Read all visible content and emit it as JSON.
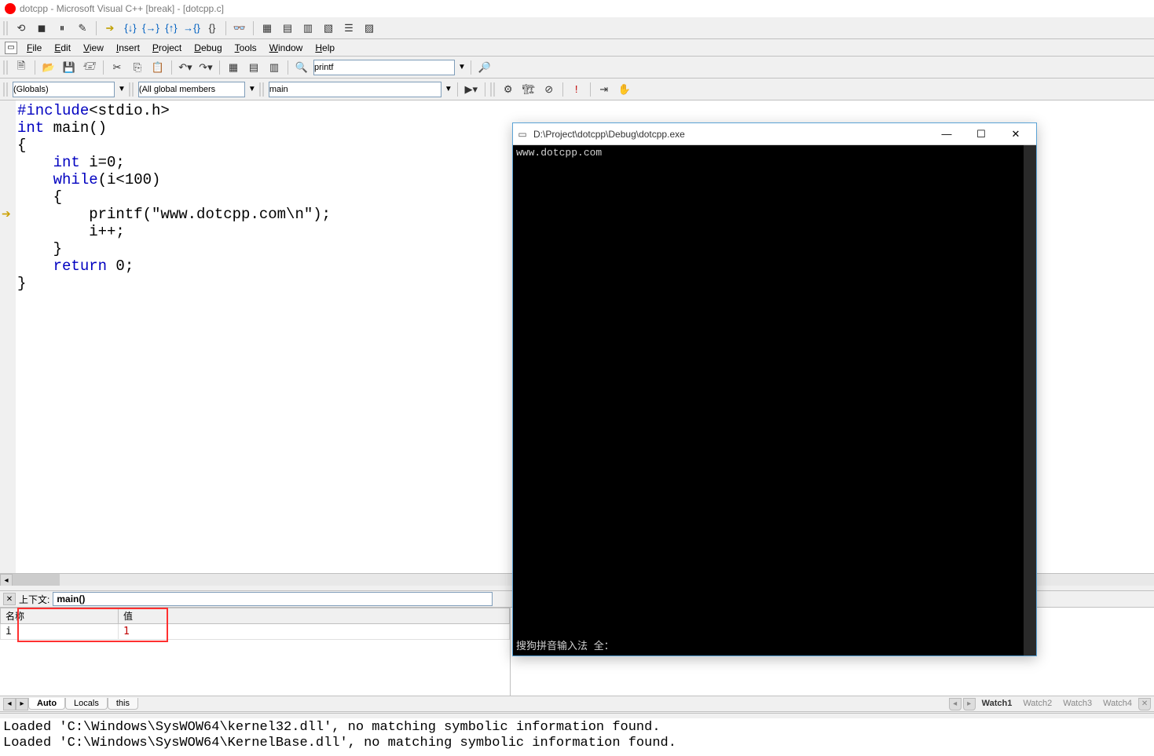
{
  "title": "dotcpp - Microsoft Visual C++ [break] - [dotcpp.c]",
  "menu": [
    "File",
    "Edit",
    "View",
    "Insert",
    "Project",
    "Debug",
    "Tools",
    "Window",
    "Help"
  ],
  "toolbar_find": "printf",
  "combos": {
    "scope": "(Globals)",
    "members": "(All global members",
    "func": "main"
  },
  "code": {
    "line1_a": "#include",
    "line1_b": "<stdio.h>",
    "line2_a": "int",
    "line2_b": " main()",
    "line3": "{",
    "line4_a": "int",
    "line4_b": " i=0;",
    "line5_a": "while",
    "line5_b": "(i<100)",
    "line6": "{",
    "line7": "printf(\"www.dotcpp.com\\n\");",
    "line8": "i++;",
    "line9": "}",
    "line10_a": "return",
    "line10_b": " 0;",
    "line11": "}"
  },
  "context": {
    "label": "上下文:",
    "value": "main()"
  },
  "locals": {
    "cols": [
      "名称",
      "值"
    ],
    "rows": [
      {
        "name": "i",
        "value": "1"
      }
    ],
    "tabs": [
      "Auto",
      "Locals",
      "this"
    ],
    "right_tabs": [
      "Watch1",
      "Watch2",
      "Watch3",
      "Watch4"
    ]
  },
  "output": {
    "line1": "Loaded 'C:\\Windows\\SysWOW64\\kernel32.dll', no matching symbolic information found.",
    "line2": "Loaded 'C:\\Windows\\SysWOW64\\KernelBase.dll', no matching symbolic information found."
  },
  "console": {
    "title": "D:\\Project\\dotcpp\\Debug\\dotcpp.exe",
    "line1": "www.dotcpp.com",
    "ime": "搜狗拼音输入法 全："
  }
}
